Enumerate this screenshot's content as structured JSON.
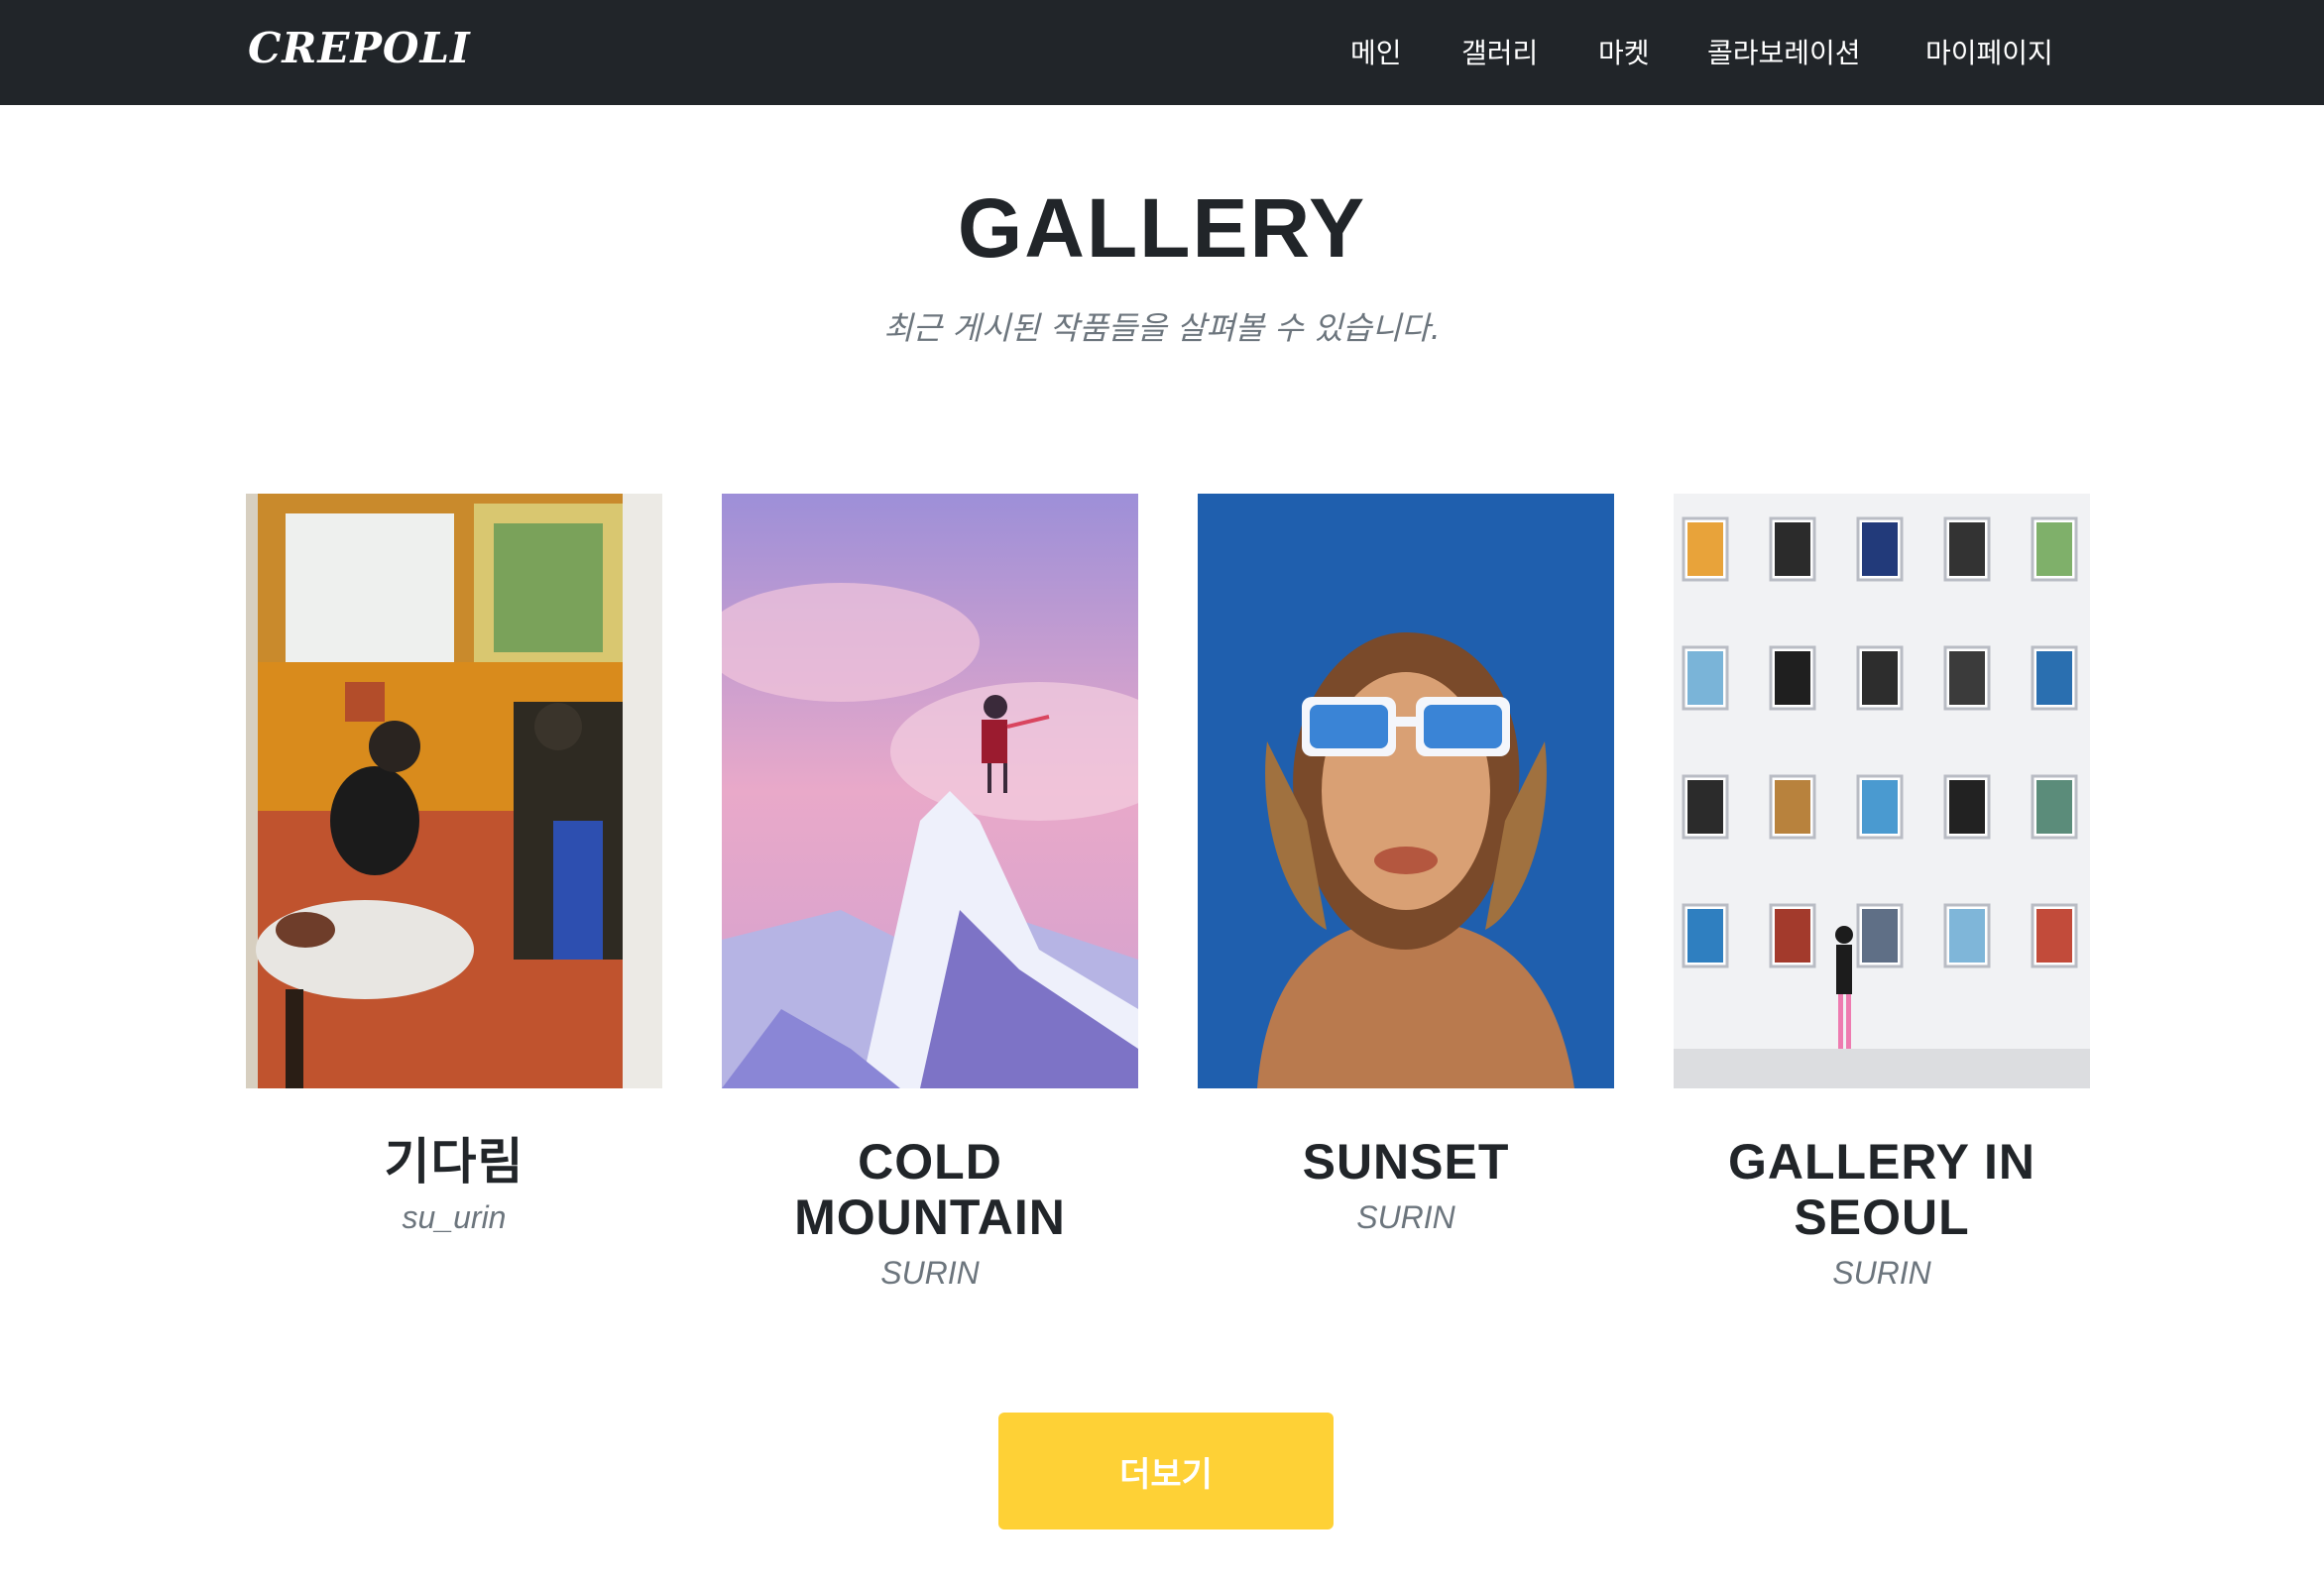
{
  "navbar": {
    "brand": "CREPOLI",
    "links": [
      "메인",
      "갤러리",
      "마켓",
      "콜라보레이션",
      "마이페이지"
    ]
  },
  "gallery": {
    "title": "GALLERY",
    "subtitle": "최근 게시된 작품들을 살펴볼 수 있습니다."
  },
  "cards": [
    {
      "title": "기다림",
      "author": "su_urin",
      "image": "painting-two-people-at-table"
    },
    {
      "title": "COLD MOUNTAIN",
      "author": "SURIN",
      "image": "illustration-person-on-chair-atop-snowy-mountain"
    },
    {
      "title": "SUNSET",
      "author": "SURIN",
      "image": "painting-face-with-white-sunglasses"
    },
    {
      "title": "GALLERY IN SEOUL",
      "author": "SURIN",
      "image": "illustration-person-viewing-portrait-wall"
    }
  ],
  "more_button": "더보기",
  "colors": {
    "navbar_bg": "#212529",
    "accent": "#fed136",
    "text_dark": "#212529",
    "text_muted": "#6c757d"
  }
}
